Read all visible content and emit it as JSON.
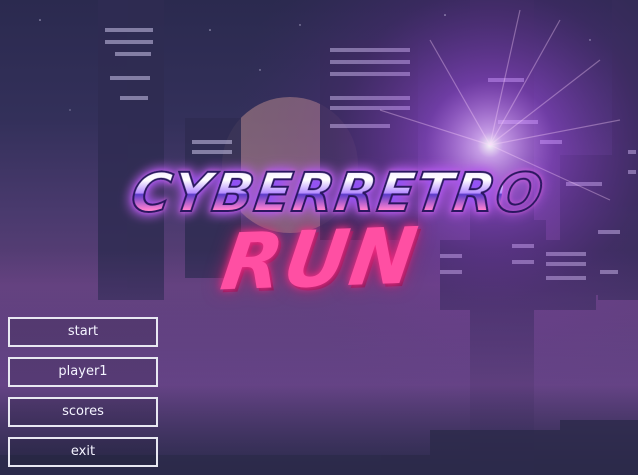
{
  "logo": {
    "line1": "CYBERRETRO",
    "line2": "RUN"
  },
  "menu": {
    "items": [
      {
        "label": "start"
      },
      {
        "label": "player1"
      },
      {
        "label": "scores"
      },
      {
        "label": "exit"
      }
    ]
  },
  "colors": {
    "sky_top": "#2b2a4f",
    "glow": "#c84dff",
    "accent_pink": "#ff4fa3",
    "button_border": "#e8e8f2"
  }
}
